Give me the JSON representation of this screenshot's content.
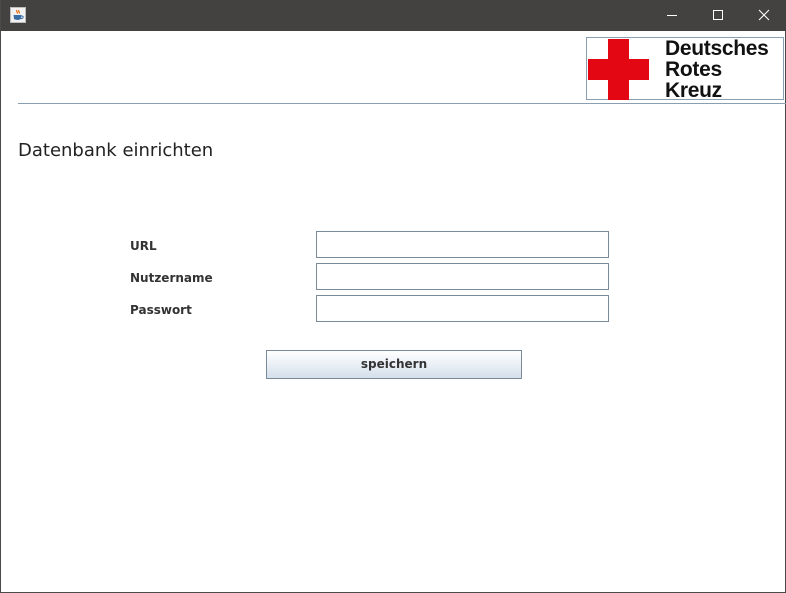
{
  "window": {
    "app_icon": "java-cup-icon",
    "controls": {
      "minimize_icon": "minimize-icon",
      "maximize_icon": "maximize-icon",
      "close_icon": "close-icon"
    },
    "titlebar_color": "#444240"
  },
  "logo": {
    "lines": [
      "Deutsches",
      "Rotes",
      "Kreuz"
    ],
    "cross_color": "#e30613"
  },
  "page": {
    "title": "Datenbank einrichten"
  },
  "form": {
    "url": {
      "label": "URL",
      "value": ""
    },
    "username": {
      "label": "Nutzername",
      "value": ""
    },
    "password": {
      "label": "Passwort",
      "value": ""
    },
    "save_label": "speichern"
  }
}
